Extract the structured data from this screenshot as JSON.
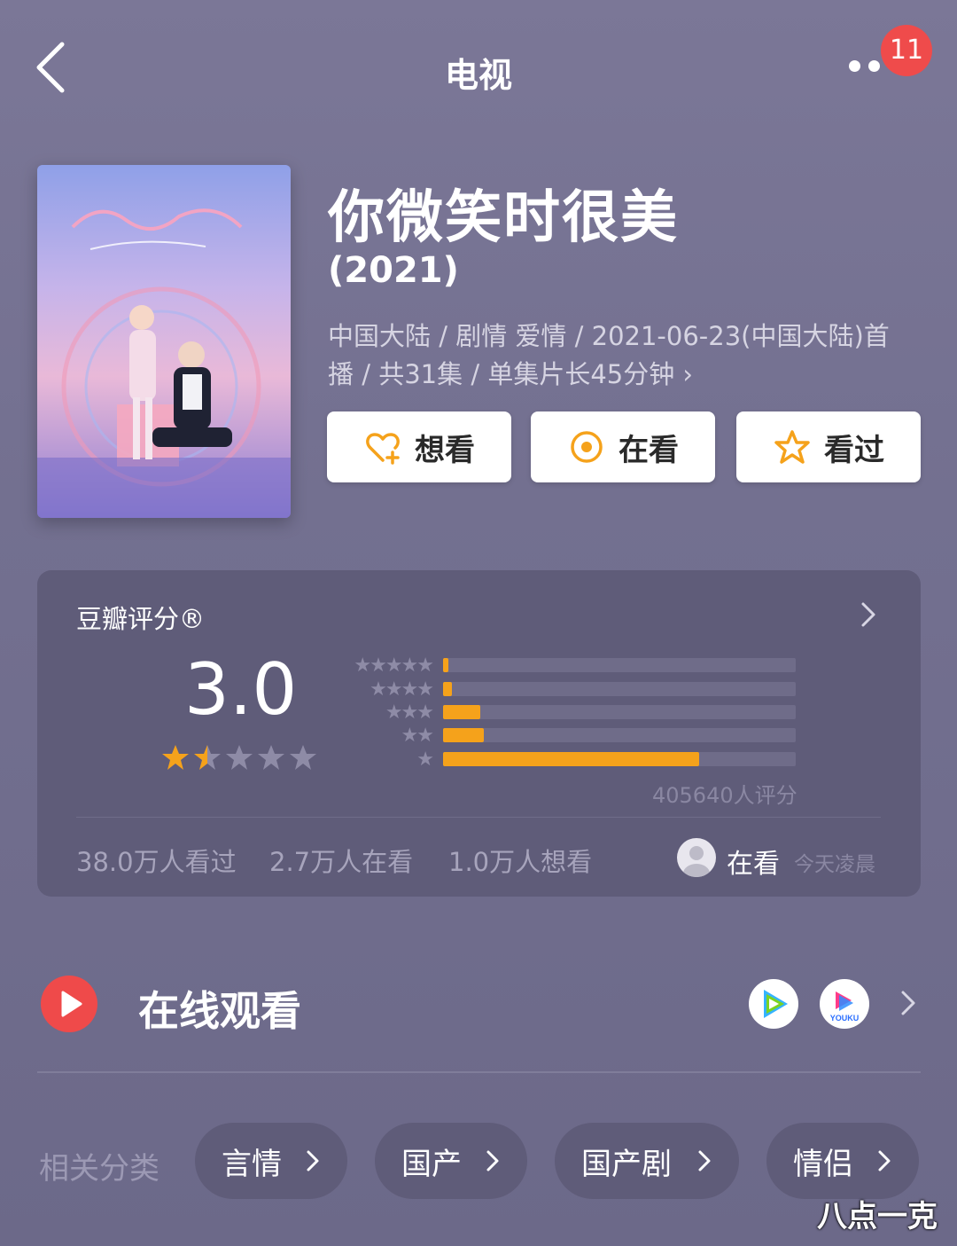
{
  "header": {
    "title": "电视",
    "notification_count": "11"
  },
  "movie": {
    "title": "你微笑时很美",
    "year": "(2021)",
    "meta_line1": "中国大陆 / 剧情 爱情 / 2021-06-23(中国大陆)首",
    "meta_line2": "播 / 共31集 / 单集片长45分钟 ›"
  },
  "actions": [
    {
      "label": "想看",
      "icon": "heart-plus-icon"
    },
    {
      "label": "在看",
      "icon": "target-icon"
    },
    {
      "label": "看过",
      "icon": "star-outline-icon"
    }
  ],
  "rating": {
    "label": "豆瓣评分®",
    "score": "3.0",
    "stars_value": 1.5,
    "count_text": "405640人评分",
    "distribution": [
      {
        "stars": "★★★★★",
        "fraction": 0.015
      },
      {
        "stars": "★★★★",
        "fraction": 0.025
      },
      {
        "stars": "★★★",
        "fraction": 0.105
      },
      {
        "stars": "★★",
        "fraction": 0.115
      },
      {
        "stars": "★",
        "fraction": 0.725
      }
    ],
    "stats": [
      "38.0万人看过",
      "2.7万人在看",
      "1.0万人想看"
    ],
    "user_status": "在看",
    "user_time": "今天凌晨"
  },
  "online": {
    "title": "在线观看",
    "platforms": [
      "tencent-video-icon",
      "youku-icon"
    ],
    "youku_text": "YOUKU"
  },
  "categories": {
    "label": "相关分类",
    "tags": [
      "言情",
      "国产",
      "国产剧",
      "情侣"
    ]
  },
  "watermark": "八点一克",
  "colors": {
    "accent": "#f5a21b",
    "badge": "#ef4b4b",
    "online": "#ef4a4a"
  }
}
